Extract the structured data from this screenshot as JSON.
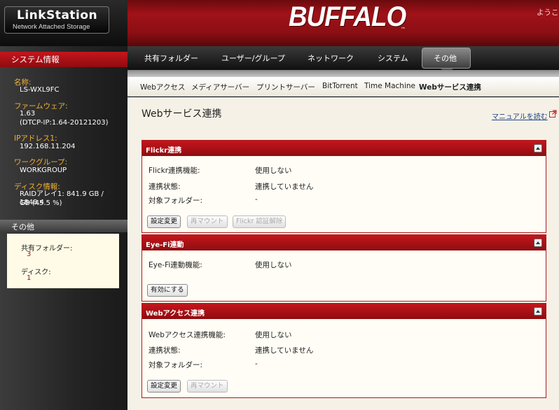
{
  "header": {
    "product_name": "LinkStation",
    "product_sub": "Network Attached Storage",
    "brand": "BUFFALO",
    "brand_tm": "™",
    "welcome": "ようこ"
  },
  "sidebar": {
    "system_title": "システム情報",
    "name_label": "名称:",
    "name_value": "LS-WXL9FC",
    "firmware_label": "ファームウェア:",
    "firmware_value": "1.63",
    "firmware_dtcp": "(DTCP-IP:1.64-20121203)",
    "ip_label": "IPアドレス1:",
    "ip_value": "192.168.11.204",
    "workgroup_label": "ワークグループ:",
    "workgroup_value": "WORKGROUP",
    "disk_label": "ディスク情報:",
    "disk_value_line1": "RAIDアレイ1: 841.9 GB / 1848.4",
    "disk_value_line2": "GB (45.5 %)",
    "other_title": "その他",
    "shared_folder_label": "共有フォルダー:",
    "shared_folder_count": "3",
    "disk_count_label": "ディスク:",
    "disk_count": "1"
  },
  "nav": {
    "items": [
      "共有フォルダー",
      "ユーザー/グループ",
      "ネットワーク",
      "システム",
      "その他"
    ]
  },
  "subnav": {
    "items": [
      "Webアクセス",
      "メディアサーバー",
      "プリントサーバー",
      "BitTorrent",
      "Time Machine",
      "Webサービス連携"
    ]
  },
  "content": {
    "page_title": "Webサービス連携",
    "manual_link": "マニュアルを読む",
    "flickr": {
      "title": "Flickr連携",
      "rows": [
        {
          "label": "Flickr連携機能:",
          "value": "使用しない"
        },
        {
          "label": "連携状態:",
          "value": "連携していません"
        },
        {
          "label": "対象フォルダー:",
          "value": "-"
        }
      ],
      "buttons": [
        "設定変更",
        "再マウント",
        "Flickr 認証解除"
      ]
    },
    "eyefi": {
      "title": "Eye-Fi連動",
      "rows": [
        {
          "label": "Eye-Fi連動機能:",
          "value": "使用しない"
        }
      ],
      "buttons": [
        "有効にする"
      ]
    },
    "webaccess": {
      "title": "Webアクセス連携",
      "rows": [
        {
          "label": "Webアクセス連携機能:",
          "value": "使用しない"
        },
        {
          "label": "連携状態:",
          "value": "連携していません"
        },
        {
          "label": "対象フォルダー:",
          "value": "-"
        }
      ],
      "buttons": [
        "設定変更",
        "再マウント"
      ]
    }
  }
}
